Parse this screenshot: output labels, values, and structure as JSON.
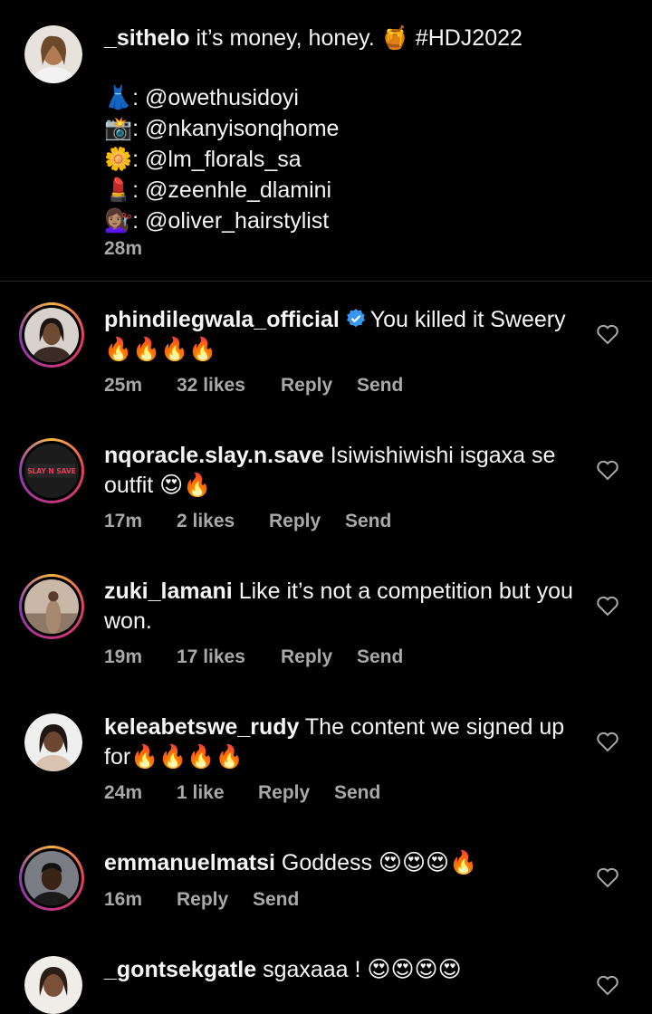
{
  "caption": {
    "username": "_sithelo",
    "text": "it’s money, honey. 🍯  #HDJ2022",
    "credits": [
      {
        "icon": "👗",
        "handle": ": @owethusidoyi"
      },
      {
        "icon": "📸",
        "handle": ": @nkanyisonqhome"
      },
      {
        "icon": "🌼",
        "handle": ": @lm_florals_sa"
      },
      {
        "icon": "💄",
        "handle": ": @zeenhle_dlamini"
      },
      {
        "icon": "💇🏽‍♀️",
        "handle": ": @oliver_hairstylist"
      }
    ],
    "time": "28m"
  },
  "comments": [
    {
      "username": "phindilegwala_official",
      "verified": true,
      "text": "You killed it Sweery 🔥🔥🔥🔥",
      "time": "25m",
      "likes": "32 likes",
      "reply": "Reply",
      "send": "Send"
    },
    {
      "username": "nqoracle.slay.n.save",
      "text": "Isiwishiwishi isgaxa se outfit 😍🔥",
      "avatar_text": "SLAY N SAVE",
      "time": "17m",
      "likes": "2 likes",
      "reply": "Reply",
      "send": "Send"
    },
    {
      "username": "zuki_lamani",
      "text": "Like it’s not a competition but you won.",
      "time": "19m",
      "likes": "17 likes",
      "reply": "Reply",
      "send": "Send"
    },
    {
      "username": "keleabetswe_rudy",
      "text": "The content we signed up for🔥🔥🔥🔥",
      "time": "24m",
      "likes": "1 like",
      "reply": "Reply",
      "send": "Send"
    },
    {
      "username": "emmanuelmatsi",
      "text": "Goddess 😍😍😍🔥",
      "time": "16m",
      "likes": "",
      "reply": "Reply",
      "send": "Send"
    },
    {
      "username": "_gontsekgatle",
      "text": "sgaxaaa ! 😍😍😍😍",
      "time": "",
      "likes": "",
      "reply": "",
      "send": ""
    }
  ],
  "colors": {
    "background": "#000000",
    "text": "#f5f5f5",
    "meta": "#a8a8a8",
    "verified": "#3897f0"
  }
}
